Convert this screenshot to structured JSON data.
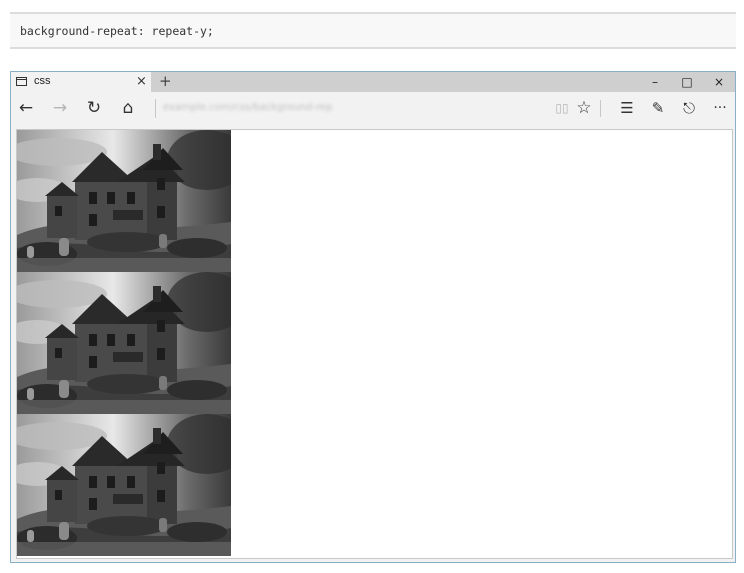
{
  "code_snippet": "background-repeat: repeat-y;",
  "browser": {
    "tab_title": "css",
    "tab_close": "×",
    "new_tab": "+",
    "window_controls": {
      "minimize": "–",
      "maximize": "□",
      "close": "×"
    },
    "nav": {
      "back": "←",
      "forward": "→",
      "refresh": "↻",
      "home": "⌂"
    },
    "address": "example.com/css/background-repeat.html",
    "toolbar_right": {
      "reading_view": "▯▯",
      "favorite": "☆",
      "hub": "☰",
      "notes": "✎",
      "share": "⎋",
      "more": "···"
    },
    "icons": [
      "page-icon",
      "back-arrow-icon",
      "forward-arrow-icon",
      "refresh-icon",
      "home-icon",
      "reading-view-icon",
      "star-icon",
      "hub-icon",
      "web-note-icon",
      "share-icon",
      "more-icon"
    ]
  },
  "content": {
    "background_image": "grayscale photo of old stone house on hill with gravestones and cloudy sky",
    "repeat_mode": "repeat-y",
    "tiles_visible": 3
  }
}
